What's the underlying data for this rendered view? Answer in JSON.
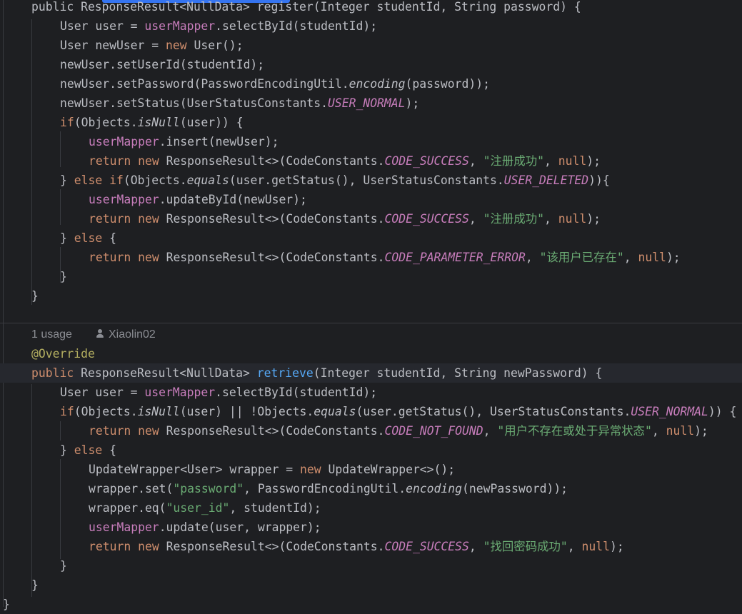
{
  "editor": {
    "inlay_hint": {
      "usages": "1 usage",
      "author": "Xiaolin02"
    },
    "register_method": {
      "l0": "public ResponseResult<NullData> register(Integer studentId, String password) {",
      "l1_a": "User user = ",
      "l1_b": "userMapper",
      "l1_c": ".selectById(studentId);",
      "l2_a": "User newUser = ",
      "l2_b": "new",
      "l2_c": " User();",
      "l3": "newUser.setUserId(studentId);",
      "l4_a": "newUser.setPassword(PasswordEncodingUtil.",
      "l4_b": "encoding",
      "l4_c": "(password));",
      "l5_a": "newUser.setStatus(UserStatusConstants.",
      "l5_b": "USER_NORMAL",
      "l5_c": ");",
      "l6_a": "if",
      "l6_b": "(Objects.",
      "l6_c": "isNull",
      "l6_d": "(user)) {",
      "l7_a": "userMapper",
      "l7_b": ".insert(newUser);",
      "l8_a": "return",
      "l8_b": " ",
      "l8_c": "new",
      "l8_d": " ResponseResult<>(CodeConstants.",
      "l8_e": "CODE_SUCCESS",
      "l8_f": ", ",
      "l8_g": "\"注册成功\"",
      "l8_h": ", ",
      "l8_i": "null",
      "l8_j": ");",
      "l9_a": "} ",
      "l9_b": "else if",
      "l9_c": "(Objects.",
      "l9_d": "equals",
      "l9_e": "(user.getStatus(), UserStatusConstants.",
      "l9_f": "USER_DELETED",
      "l9_g": ")){",
      "l10_a": "userMapper",
      "l10_b": ".updateById(newUser);",
      "l11_a": "return",
      "l11_b": " ",
      "l11_c": "new",
      "l11_d": " ResponseResult<>(CodeConstants.",
      "l11_e": "CODE_SUCCESS",
      "l11_f": ", ",
      "l11_g": "\"注册成功\"",
      "l11_h": ", ",
      "l11_i": "null",
      "l11_j": ");",
      "l12_a": "} ",
      "l12_b": "else",
      "l12_c": " {",
      "l13_a": "return",
      "l13_b": " ",
      "l13_c": "new",
      "l13_d": " ResponseResult<>(CodeConstants.",
      "l13_e": "CODE_PARAMETER_ERROR",
      "l13_f": ", ",
      "l13_g": "\"该用户已存在\"",
      "l13_h": ", ",
      "l13_i": "null",
      "l13_j": ");",
      "l14": "}",
      "l15": "}"
    },
    "retrieve_method": {
      "l17": "@Override",
      "l18_a": "public",
      "l18_b": " ResponseResult<NullData> ",
      "l18_c": "retrieve",
      "l18_d": "(Integer studentId, String newPassword) {",
      "l19_a": "User user = ",
      "l19_b": "userMapper",
      "l19_c": ".selectById(studentId);",
      "l20_a": "if",
      "l20_b": "(Objects.",
      "l20_c": "isNull",
      "l20_d": "(user) || !Objects.",
      "l20_e": "equals",
      "l20_f": "(user.getStatus(), UserStatusConstants.",
      "l20_g": "USER_NORMAL",
      "l20_h": ")) {",
      "l21_a": "return",
      "l21_b": " ",
      "l21_c": "new",
      "l21_d": " ResponseResult<>(CodeConstants.",
      "l21_e": "CODE_NOT_FOUND",
      "l21_f": ", ",
      "l21_g": "\"用户不存在或处于异常状态\"",
      "l21_h": ", ",
      "l21_i": "null",
      "l21_j": ");",
      "l22_a": "} ",
      "l22_b": "else",
      "l22_c": " {",
      "l23_a": "UpdateWrapper<User> wrapper = ",
      "l23_b": "new",
      "l23_c": " UpdateWrapper<>();",
      "l24_a": "wrapper.set(",
      "l24_b": "\"password\"",
      "l24_c": ", PasswordEncodingUtil.",
      "l24_d": "encoding",
      "l24_e": "(newPassword));",
      "l25_a": "wrapper.eq(",
      "l25_b": "\"user_id\"",
      "l25_c": ", studentId);",
      "l26_a": "userMapper",
      "l26_b": ".update(user, wrapper);",
      "l27_a": "return",
      "l27_b": " ",
      "l27_c": "new",
      "l27_d": " ResponseResult<>(CodeConstants.",
      "l27_e": "CODE_SUCCESS",
      "l27_f": ", ",
      "l27_g": "\"找回密码成功\"",
      "l27_h": ", ",
      "l27_i": "null",
      "l27_j": ");",
      "l28": "}",
      "l29": "}"
    },
    "class_close": "}"
  },
  "colors": {
    "background": "#1e1f22",
    "keyword": "#cf8e6d",
    "field": "#c77dbb",
    "string": "#6aab73",
    "method_declaration": "#56a8f5",
    "annotation": "#b3ae60",
    "default_text": "#bcbec4",
    "hint_text": "#8b8d93"
  }
}
